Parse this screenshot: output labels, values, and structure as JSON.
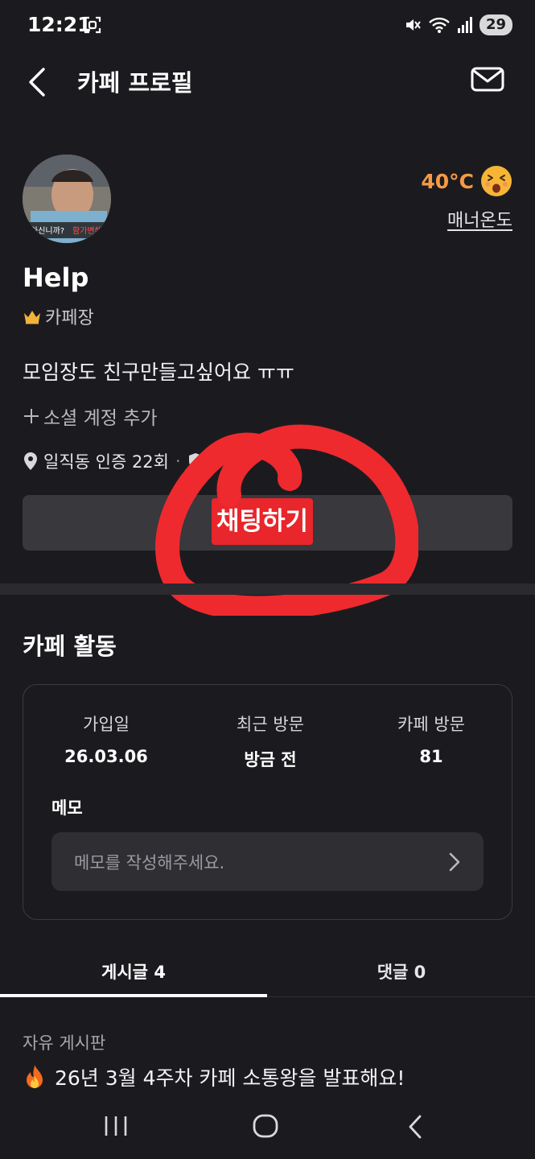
{
  "status_bar": {
    "time": "12:21",
    "battery": "29"
  },
  "header": {
    "title": "카페 프로필"
  },
  "profile": {
    "avatar_caption_left": "하신니까?",
    "avatar_caption_right": "함가변해",
    "temperature": "40°C",
    "manner_label": "매너온도",
    "nickname": "Help",
    "role": "카페장",
    "bio": "모임장도 친구만들고싶어요 ㅠㅠ",
    "add_social": "소셜 계정 추가",
    "location_verify": "일직동 인증 22회",
    "separator": "·"
  },
  "chat_button": {
    "label": "채팅하기"
  },
  "activity": {
    "title": "카페 활동",
    "stats": [
      {
        "label": "가입일",
        "value": "26.03.06"
      },
      {
        "label": "최근 방문",
        "value": "방금 전"
      },
      {
        "label": "카페 방문",
        "value": "81"
      }
    ],
    "memo_title": "메모",
    "memo_placeholder": "메모를 작성해주세요."
  },
  "tabs": [
    {
      "label": "게시글 4",
      "active": true
    },
    {
      "label": "댓글 0",
      "active": false
    }
  ],
  "post": {
    "board": "자유 게시판",
    "title": "26년 3월 4주차 카페 소통왕을 발표해요!"
  },
  "colors": {
    "background": "#1b1b1f",
    "accent_temperature": "#f59a47",
    "chat_highlight": "#e8262b",
    "scribble": "#ee2a2e"
  }
}
